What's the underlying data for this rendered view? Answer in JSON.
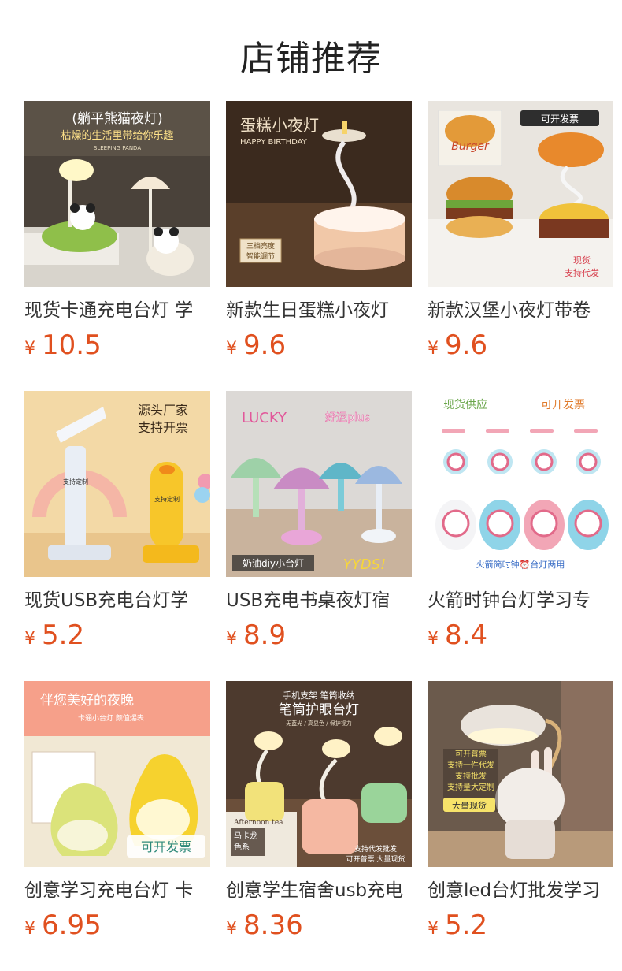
{
  "section": {
    "title": "店铺推荐"
  },
  "currency": "¥",
  "products": [
    {
      "name": "现货卡通充电台灯 学",
      "price": "10.5",
      "image_text": [
        "(躺平熊猫夜灯)",
        "枯燥的生活里带给你乐趣",
        "SLEEPING PANDA"
      ]
    },
    {
      "name": "新款生日蛋糕小夜灯",
      "price": "9.6",
      "image_text": [
        "蛋糕小夜灯",
        "HAPPY BIRTHDAY",
        "三档亮度",
        "智能调节"
      ]
    },
    {
      "name": "新款汉堡小夜灯带卷",
      "price": "9.6",
      "image_text": [
        "可开发票",
        "Burger",
        "现货",
        "支持代发"
      ]
    },
    {
      "name": "现货USB充电台灯学",
      "price": "5.2",
      "image_text": [
        "源头厂家",
        "支持开票",
        "支持定制",
        "支持定制"
      ]
    },
    {
      "name": "USB充电书桌夜灯宿",
      "price": "8.9",
      "image_text": [
        "LUCKY",
        "好运plus",
        "奶油diy小台灯",
        "YYDS!"
      ]
    },
    {
      "name": "火箭时钟台灯学习专",
      "price": "8.4",
      "image_text": [
        "现货供应",
        "可开发票",
        "火箭简时钟⏰台灯两用"
      ]
    },
    {
      "name": "创意学习充电台灯 卡",
      "price": "6.95",
      "image_text": [
        "伴您美好的夜晚",
        "卡通小台灯 颜值爆表",
        "可开发票"
      ]
    },
    {
      "name": "创意学生宿舍usb充电",
      "price": "8.36",
      "image_text": [
        "手机支架 笔筒收纳",
        "笔筒护眼台灯",
        "无蓝光 / 高显色 / 保护视力",
        "马卡龙",
        "色系",
        "支持代发批发",
        "可开普票 大量现货",
        "Afternoon tea"
      ]
    },
    {
      "name": "创意led台灯批发学习",
      "price": "5.2",
      "image_text": [
        "可开普票",
        "支持一件代发",
        "支持批发",
        "支持量大定制",
        "大量现货"
      ]
    }
  ],
  "icons": [
    "panda-lamp-image",
    "cake-lamp-image",
    "burger-lamp-image",
    "duck-lamp-image",
    "flower-lamp-image",
    "rocket-clock-image",
    "pear-lamp-image",
    "pen-holder-lamp-image",
    "rabbit-lamp-image"
  ],
  "colors": {
    "price": "#e0501f",
    "title": "#222222",
    "name": "#333333"
  }
}
